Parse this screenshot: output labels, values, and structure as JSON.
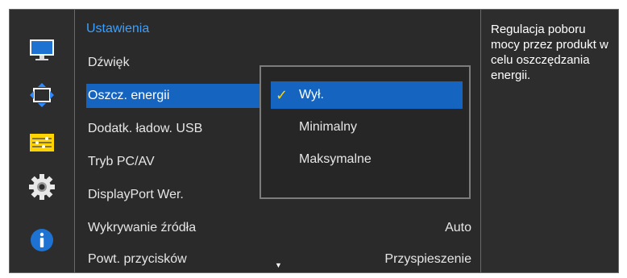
{
  "panel_title": "Ustawienia",
  "sidebar": {
    "icons": [
      "monitor-icon",
      "picture-size-icon",
      "system-icon",
      "settings-gear-icon",
      "info-icon"
    ],
    "active_index": 3
  },
  "menu": {
    "items": [
      {
        "label": "Dźwięk",
        "value": ""
      },
      {
        "label": "Oszcz. energii",
        "value": ""
      },
      {
        "label": "Dodatk. ładow. USB",
        "value": ""
      },
      {
        "label": "Tryb PC/AV",
        "value": ""
      },
      {
        "label": "DisplayPort Wer.",
        "value": ""
      },
      {
        "label": "Wykrywanie źródła",
        "value": "Auto"
      },
      {
        "label": "Powt. przycisków",
        "value": "Przyspieszenie"
      }
    ],
    "selected_index": 1,
    "scroll_down_glyph": "▼"
  },
  "popup": {
    "options": [
      "Wył.",
      "Minimalny",
      "Maksymalne"
    ],
    "selected_index": 0,
    "check_glyph": "✓"
  },
  "help_text": "Regulacja poboru mocy przez produkt w celu oszczędzania energii.",
  "colors": {
    "accent": "#1565c0",
    "title": "#3ba0ff",
    "check": "#ffd400",
    "background": "#2d2d2d"
  }
}
